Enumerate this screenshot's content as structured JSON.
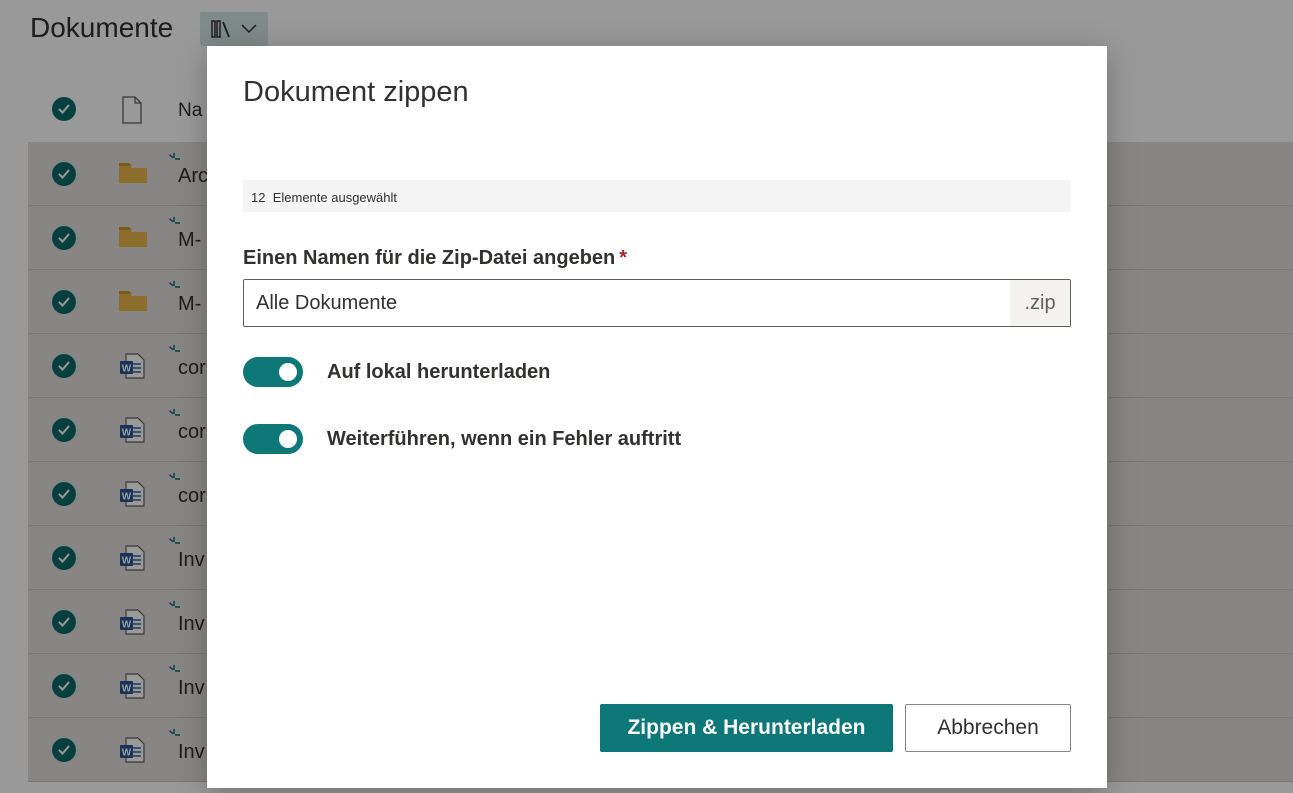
{
  "page": {
    "title": "Dokumente",
    "view_icon": "library-icon",
    "header_name_label": "Na"
  },
  "rows": [
    {
      "type": "folder",
      "name": "Arc"
    },
    {
      "type": "folder",
      "name": "M-"
    },
    {
      "type": "folder",
      "name": "M-"
    },
    {
      "type": "word",
      "name": "cor"
    },
    {
      "type": "word",
      "name": "cor"
    },
    {
      "type": "word",
      "name": "cor"
    },
    {
      "type": "word",
      "name": "Inv"
    },
    {
      "type": "word",
      "name": "Inv"
    },
    {
      "type": "word",
      "name": "Inv"
    },
    {
      "type": "word",
      "name": "Inv"
    }
  ],
  "dialog": {
    "title": "Dokument zippen",
    "selection_count": "12",
    "selection_text": "Elemente ausgewählt",
    "name_label": "Einen Namen für die Zip-Datei angeben",
    "required_mark": "*",
    "name_value": "Alle Dokumente",
    "extension": ".zip",
    "toggle_download_label": "Auf lokal herunterladen",
    "toggle_download_on": true,
    "toggle_continue_label": "Weiterführen, wenn ein Fehler auftritt",
    "toggle_continue_on": true,
    "primary_button": "Zippen & Herunterladen",
    "cancel_button": "Abbrechen"
  },
  "colors": {
    "accent": "#0e7878",
    "check": "#0e6b6b",
    "folder": "#e8b84a",
    "word": "#2b579a",
    "required": "#a4262c"
  }
}
